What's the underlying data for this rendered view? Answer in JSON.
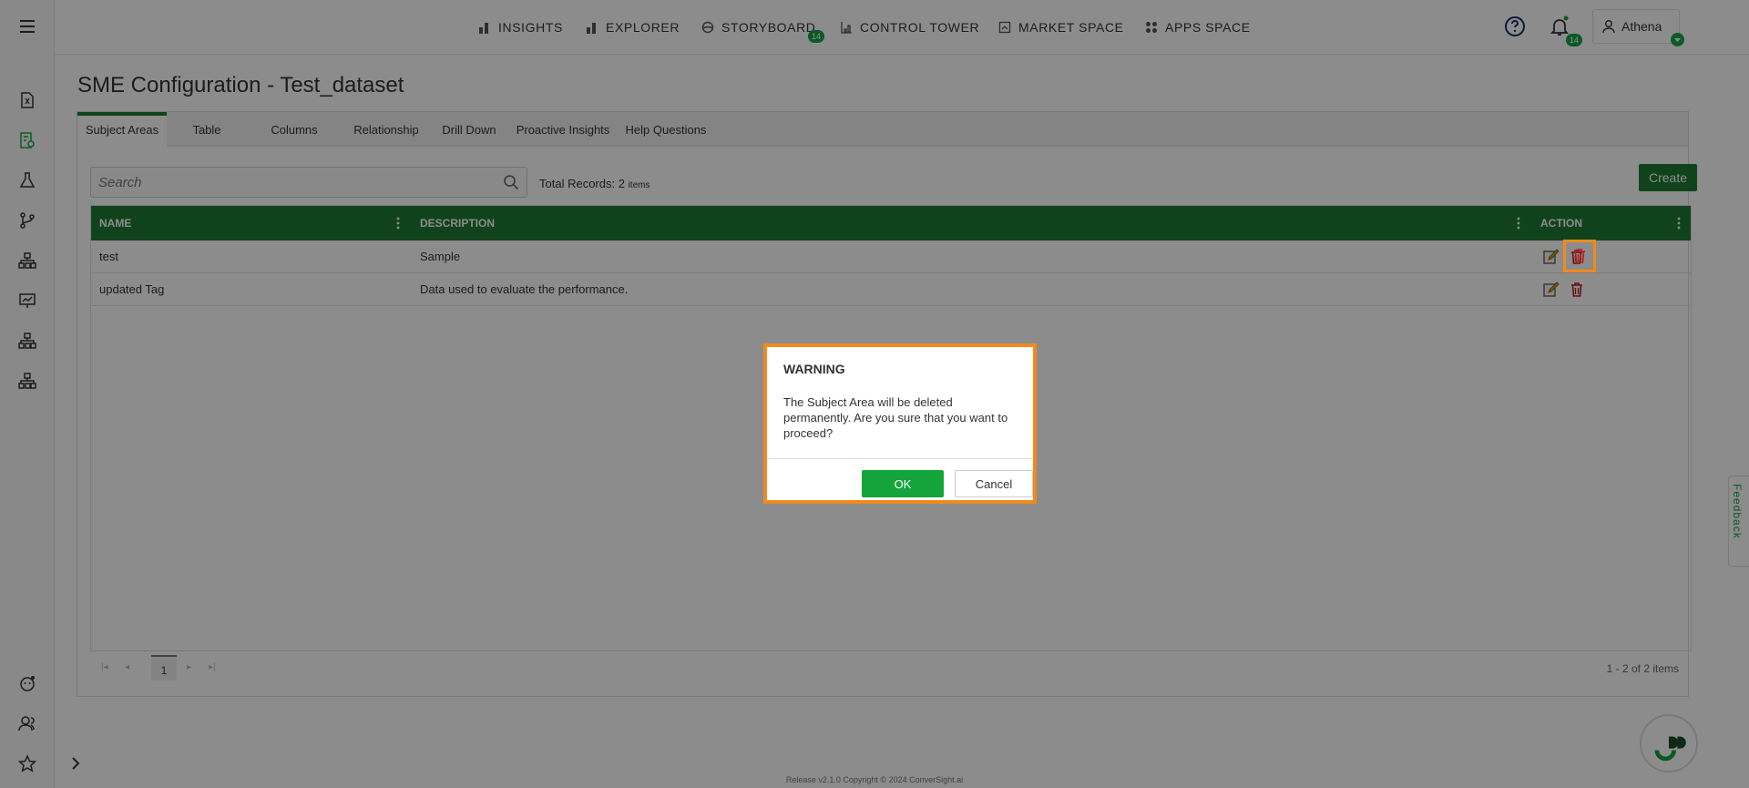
{
  "nav": {
    "items": [
      {
        "label": "INSIGHTS",
        "icon": "bar-chart-icon"
      },
      {
        "label": "EXPLORER",
        "icon": "bar-chart-icon"
      },
      {
        "label": "STORYBOARD",
        "icon": "storyboard-icon",
        "badge": "14"
      },
      {
        "label": "CONTROL TOWER",
        "icon": "control-tower-icon"
      },
      {
        "label": "MARKET SPACE",
        "icon": "market-space-icon"
      },
      {
        "label": "APPS SPACE",
        "icon": "apps-grid-icon"
      }
    ],
    "notification_badge": "14",
    "user_name": "Athena"
  },
  "page": {
    "title": "SME Configuration - Test_dataset"
  },
  "tabs": [
    {
      "label": "Subject Areas",
      "active": true
    },
    {
      "label": "Table"
    },
    {
      "label": "Columns"
    },
    {
      "label": "Relationship"
    },
    {
      "label": "Drill Down"
    },
    {
      "label": "Proactive Insights"
    },
    {
      "label": "Help Questions"
    }
  ],
  "toolbar": {
    "search_placeholder": "Search",
    "total_label": "Total Records: 2",
    "total_unit": "items",
    "create_label": "Create"
  },
  "grid": {
    "columns": [
      "NAME",
      "DESCRIPTION",
      "ACTION"
    ],
    "rows": [
      {
        "name": "test",
        "description": "Sample"
      },
      {
        "name": "updated Tag",
        "description": "Data used to evaluate the performance."
      }
    ]
  },
  "pager": {
    "current_page": "1",
    "info": "1 - 2 of 2 items"
  },
  "feedback_label": "Feedback",
  "footer": "Release v2.1.0 Copyright © 2024 ConverSight.ai",
  "modal": {
    "title": "WARNING",
    "message": "The Subject Area will be deleted permanently. Are you sure that you want to proceed?",
    "ok_label": "OK",
    "cancel_label": "Cancel"
  },
  "colors": {
    "brand_green": "#1e7a34",
    "ok_green": "#13a53b",
    "highlight_orange": "#f08a1c",
    "delete_red": "#b5201f"
  }
}
